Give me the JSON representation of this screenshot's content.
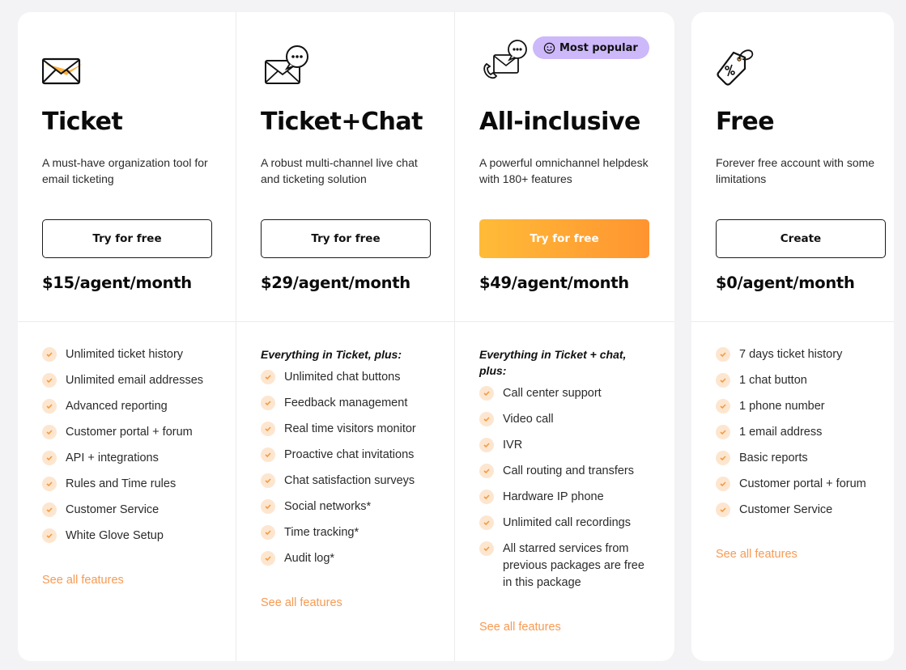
{
  "plans": [
    {
      "icon": "envelope-icon",
      "name": "Ticket",
      "description": "A must-have organization tool for email ticketing",
      "button_label": "Try for free",
      "price": "$15/agent/month",
      "includes_label": null,
      "features": [
        "Unlimited ticket history",
        "Unlimited email addresses",
        "Advanced reporting",
        "Customer portal + forum",
        "API + integrations",
        "Rules and Time rules",
        "Customer Service",
        "White Glove Setup"
      ],
      "link_label": "See all features"
    },
    {
      "icon": "envelope-chat-icon",
      "name": "Ticket+Chat",
      "description": "A robust multi-channel live chat and ticketing solution",
      "button_label": "Try for free",
      "price": "$29/agent/month",
      "includes_label": "Everything in Ticket, plus:",
      "features": [
        "Unlimited chat buttons",
        "Feedback management",
        "Real time visitors monitor",
        "Proactive chat invitations",
        "Chat satisfaction surveys",
        "Social networks*",
        "Time tracking*",
        "Audit log*"
      ],
      "link_label": "See all features"
    },
    {
      "icon": "phone-envelope-chat-icon",
      "name": "All-inclusive",
      "badge": "Most popular",
      "description": "A powerful omnichannel helpdesk with 180+ features",
      "button_label": "Try for free",
      "price": "$49/agent/month",
      "includes_label": "Everything in Ticket + chat, plus:",
      "features": [
        "Call center support",
        "Video call",
        "IVR",
        "Call routing and transfers",
        "Hardware IP phone",
        "Unlimited call recordings",
        "All starred services from previous packages are free in this package"
      ],
      "link_label": "See all features"
    },
    {
      "icon": "price-tag-icon",
      "name": "Free",
      "description": "Forever free account with some limitations",
      "button_label": "Create",
      "price": "$0/agent/month",
      "includes_label": null,
      "features": [
        "7 days ticket history",
        "1 chat button",
        "1 phone number",
        "1 email address",
        "Basic reports",
        "Customer portal + forum",
        "Customer Service"
      ],
      "link_label": "See all features"
    }
  ],
  "colors": {
    "accent_orange": "#ff9f2e",
    "badge_purple": "#cdb8fa",
    "check_bg": "#fde6d0",
    "link_orange": "#f79a52",
    "page_bg": "#f3f3f5"
  }
}
